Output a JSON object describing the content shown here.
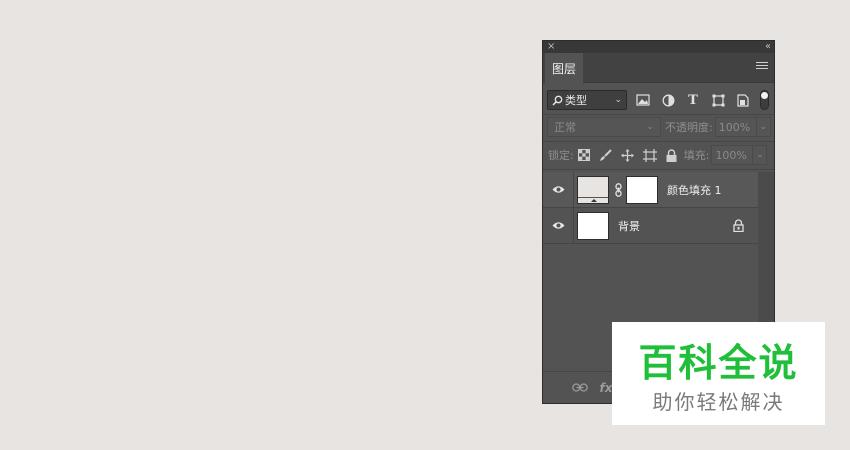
{
  "panel": {
    "close_glyph": "×",
    "collapse_glyph": "‹‹",
    "tab_label": "图层"
  },
  "filter": {
    "select_label": "类型",
    "search_glyph": "⌕",
    "chevron": "⌄",
    "icons": [
      "image-filter-icon",
      "adjustment-filter-icon",
      "type-filter-icon",
      "shape-filter-icon",
      "smartobject-filter-icon"
    ],
    "type_glyph": "T"
  },
  "blend": {
    "mode": "正常",
    "opacity_label": "不透明度:",
    "opacity_value": "100%",
    "chevron": "⌄"
  },
  "lock": {
    "label": "锁定:",
    "fill_label": "填充:",
    "fill_value": "100%",
    "chevron": "⌄"
  },
  "layers": [
    {
      "name": "颜色填充 1",
      "type": "fill",
      "has_mask": true
    },
    {
      "name": "背景",
      "type": "background",
      "locked": true
    }
  ],
  "bottom": {
    "fx_label": "fx"
  },
  "watermark": {
    "title": "百科全说",
    "subtitle": "助你轻松解决"
  },
  "colors": {
    "panel_bg": "#535353",
    "canvas_bg": "#e8e4e1",
    "watermark_green": "#1fbf3a"
  }
}
